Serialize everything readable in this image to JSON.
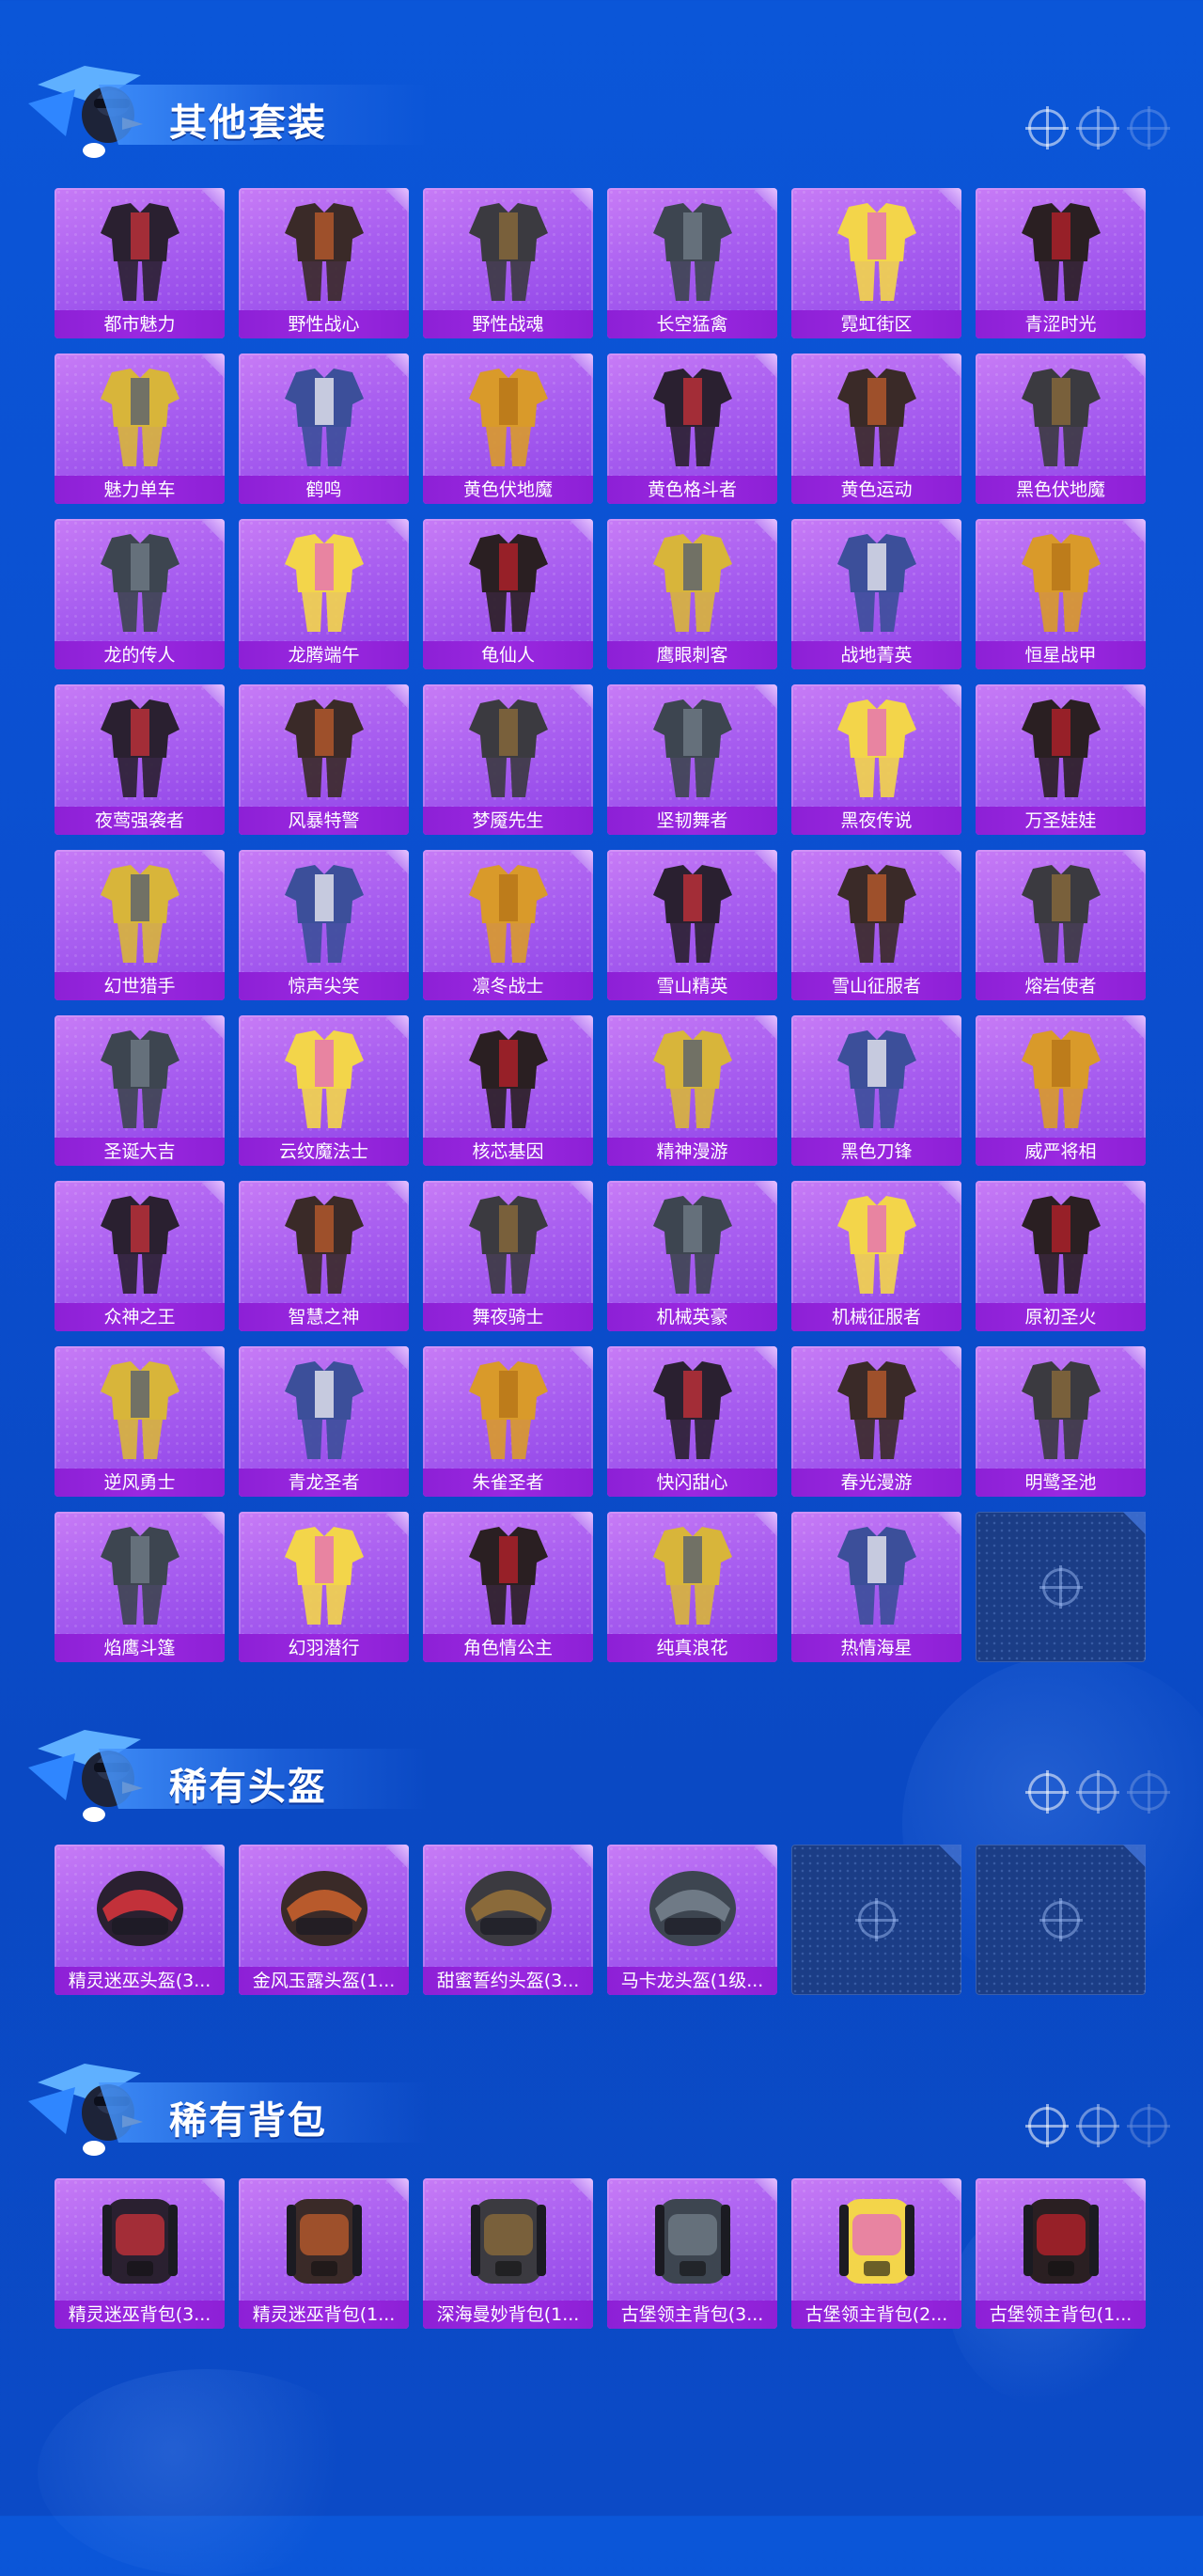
{
  "colors": {
    "background": "#0b56d8",
    "card": "#a95ff0",
    "label_bar": "#8d20d6",
    "empty_slot": "#1b3d86",
    "title_text": "#ffffff"
  },
  "sections": [
    {
      "title": "其他套装",
      "items": [
        "都市魅力",
        "野性战心",
        "野性战魂",
        "长空猛禽",
        "霓虹街区",
        "青涩时光",
        "魅力单车",
        "鹤鸣",
        "黄色伏地魔",
        "黄色格斗者",
        "黄色运动",
        "黑色伏地魔",
        "龙的传人",
        "龙腾端午",
        "龟仙人",
        "鹰眼刺客",
        "战地菁英",
        "恒星战甲",
        "夜莺强袭者",
        "风暴特警",
        "梦魇先生",
        "坚韧舞者",
        "黑夜传说",
        "万圣娃娃",
        "幻世猎手",
        "惊声尖笑",
        "凛冬战士",
        "雪山精英",
        "雪山征服者",
        "熔岩使者",
        "圣诞大吉",
        "云纹魔法士",
        "核芯基因",
        "精神漫游",
        "黑色刀锋",
        "威严将相",
        "众神之王",
        "智慧之神",
        "舞夜骑士",
        "机械英豪",
        "机械征服者",
        "原初圣火",
        "逆风勇士",
        "青龙圣者",
        "朱雀圣者",
        "快闪甜心",
        "春光漫游",
        "明鹭圣池",
        "焰鹰斗篷",
        "幻羽潜行",
        "角色情公主",
        "纯真浪花",
        "热情海星"
      ],
      "empty_slots": 1
    },
    {
      "title": "稀有头盔",
      "items": [
        "精灵迷巫头盔(3...",
        "金风玉露头盔(1...",
        "甜蜜誓约头盔(3...",
        "马卡龙头盔(1级..."
      ],
      "empty_slots": 2
    },
    {
      "title": "稀有背包",
      "items": [
        "精灵迷巫背包(3...",
        "精灵迷巫背包(1...",
        "深海曼妙背包(1...",
        "古堡领主背包(3...",
        "古堡领主背包(2...",
        "古堡领主背包(1..."
      ],
      "empty_slots": 0
    }
  ]
}
